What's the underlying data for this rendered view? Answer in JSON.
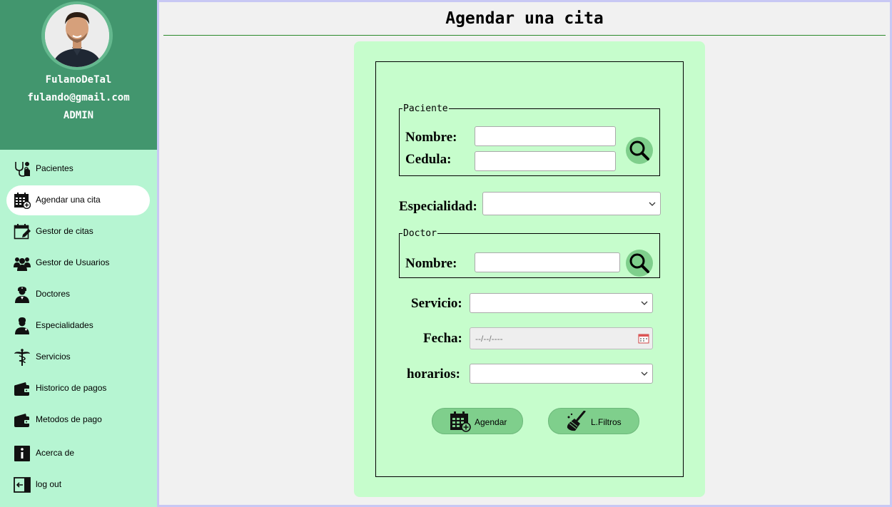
{
  "profile": {
    "username": "FulanoDeTal",
    "email": "fulando@gmail.com",
    "role": "ADMIN"
  },
  "sidebar": {
    "items": [
      {
        "label": "Pacientes",
        "icon": "stethoscope-icon"
      },
      {
        "label": "Agendar una cita",
        "icon": "calendar-add-icon",
        "active": true
      },
      {
        "label": "Gestor de citas",
        "icon": "calendar-edit-icon"
      },
      {
        "label": "Gestor de Usuarios",
        "icon": "users-icon"
      },
      {
        "label": "Doctores",
        "icon": "doctor-icon"
      },
      {
        "label": "Especialidades",
        "icon": "specialist-icon"
      },
      {
        "label": "Servicios",
        "icon": "caduceus-icon"
      },
      {
        "label": "Historico de pagos",
        "icon": "wallet-icon"
      },
      {
        "label": "Metodos de pago",
        "icon": "wallet-icon"
      },
      {
        "label": "Acerca de",
        "icon": "info-icon"
      },
      {
        "label": "log out",
        "icon": "logout-icon"
      }
    ]
  },
  "page": {
    "title": "Agendar una cita"
  },
  "form": {
    "paciente": {
      "legend": "Paciente",
      "nombre_label": "Nombre:",
      "nombre_value": "",
      "cedula_label": "Cedula:",
      "cedula_value": ""
    },
    "especialidad": {
      "label": "Especialidad:",
      "value": ""
    },
    "doctor": {
      "legend": "Doctor",
      "nombre_label": "Nombre:",
      "nombre_value": ""
    },
    "servicio": {
      "label": "Servicio:",
      "value": ""
    },
    "fecha": {
      "label": "Fecha:",
      "placeholder": "--/--/----"
    },
    "horarios": {
      "label": "horarios:",
      "value": ""
    },
    "buttons": {
      "agendar": "Agendar",
      "limpiar": "L.Filtros"
    }
  },
  "colors": {
    "sidebar_bg": "#b6f5d2",
    "profile_bg": "#42966e",
    "card_bg": "#c6fdcc",
    "button_bg": "#7fcf8c",
    "title_rule": "#2a8a2a"
  }
}
